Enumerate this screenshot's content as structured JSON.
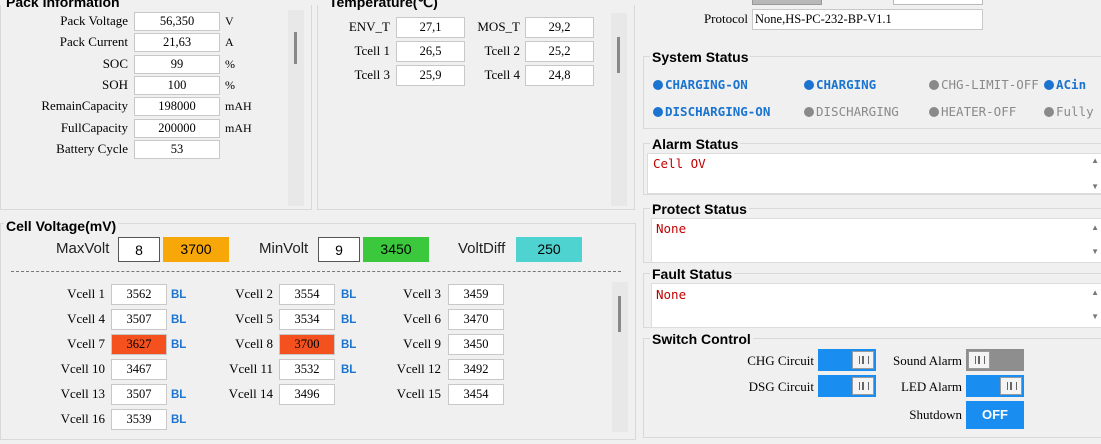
{
  "pack": {
    "title": "Pack Information",
    "rows": [
      {
        "label": "Pack Voltage",
        "value": "56,350",
        "unit": "V"
      },
      {
        "label": "Pack Current",
        "value": "21,63",
        "unit": "A"
      },
      {
        "label": "SOC",
        "value": "99",
        "unit": "%"
      },
      {
        "label": "SOH",
        "value": "100",
        "unit": "%"
      },
      {
        "label": "RemainCapacity",
        "value": "198000",
        "unit": "mAH"
      },
      {
        "label": "FullCapacity",
        "value": "200000",
        "unit": "mAH"
      },
      {
        "label": "Battery Cycle",
        "value": "53",
        "unit": ""
      }
    ]
  },
  "temperature": {
    "title": "Temperature(℃)",
    "items": [
      {
        "label": "ENV_T",
        "value": "27,1"
      },
      {
        "label": "MOS_T",
        "value": "29,2"
      },
      {
        "label": "Tcell 1",
        "value": "26,5"
      },
      {
        "label": "Tcell 2",
        "value": "25,2"
      },
      {
        "label": "Tcell 3",
        "value": "25,9"
      },
      {
        "label": "Tcell 4",
        "value": "24,8"
      }
    ]
  },
  "cellvolt": {
    "title": "Cell Voltage(mV)",
    "max_label": "MaxVolt",
    "max_index": "8",
    "max_value": "3700",
    "min_label": "MinVolt",
    "min_index": "9",
    "min_value": "3450",
    "diff_label": "VoltDiff",
    "diff_value": "250",
    "balance_tag": "BL",
    "cells": [
      {
        "label": "Vcell 1",
        "value": "3562",
        "bl": true,
        "hl": false
      },
      {
        "label": "Vcell 2",
        "value": "3554",
        "bl": true,
        "hl": false
      },
      {
        "label": "Vcell 3",
        "value": "3459",
        "bl": false,
        "hl": false
      },
      {
        "label": "Vcell 4",
        "value": "3507",
        "bl": true,
        "hl": false
      },
      {
        "label": "Vcell 5",
        "value": "3534",
        "bl": true,
        "hl": false
      },
      {
        "label": "Vcell 6",
        "value": "3470",
        "bl": false,
        "hl": false
      },
      {
        "label": "Vcell 7",
        "value": "3627",
        "bl": true,
        "hl": true
      },
      {
        "label": "Vcell 8",
        "value": "3700",
        "bl": true,
        "hl": true
      },
      {
        "label": "Vcell 9",
        "value": "3450",
        "bl": false,
        "hl": false
      },
      {
        "label": "Vcell 10",
        "value": "3467",
        "bl": false,
        "hl": false
      },
      {
        "label": "Vcell 11",
        "value": "3532",
        "bl": true,
        "hl": false
      },
      {
        "label": "Vcell 12",
        "value": "3492",
        "bl": false,
        "hl": false
      },
      {
        "label": "Vcell 13",
        "value": "3507",
        "bl": true,
        "hl": false
      },
      {
        "label": "Vcell 14",
        "value": "3496",
        "bl": false,
        "hl": false
      },
      {
        "label": "Vcell 15",
        "value": "3454",
        "bl": false,
        "hl": false
      },
      {
        "label": "Vcell 16",
        "value": "3539",
        "bl": true,
        "hl": false
      }
    ]
  },
  "protocol": {
    "label": "Protocol",
    "value": "None,HS-PC-232-BP-V1.1"
  },
  "system_status": {
    "title": "System Status",
    "items": [
      {
        "text": "CHARGING-ON",
        "on": true
      },
      {
        "text": "CHARGING",
        "on": true
      },
      {
        "text": "CHG-LIMIT-OFF",
        "on": false
      },
      {
        "text": "ACin",
        "on": true
      },
      {
        "text": "DISCHARGING-ON",
        "on": true
      },
      {
        "text": "DISCHARGING",
        "on": false
      },
      {
        "text": "HEATER-OFF",
        "on": false
      },
      {
        "text": "Fully",
        "on": false
      }
    ]
  },
  "alarm": {
    "title": "Alarm Status",
    "text": "Cell OV"
  },
  "protect": {
    "title": "Protect Status",
    "text": "None"
  },
  "fault": {
    "title": "Fault Status",
    "text": "None"
  },
  "switch": {
    "title": "Switch Control",
    "chg_label": "CHG Circuit",
    "dsg_label": "DSG Circuit",
    "sound_label": "Sound Alarm",
    "led_label": "LED Alarm",
    "shutdown_label": "Shutdown",
    "shutdown_button": "OFF"
  },
  "colors": {
    "accent": "#1a74d0",
    "max_box": "#f7a808",
    "min_box": "#3cc83c",
    "diff_box": "#4fd3d0",
    "cell_highlight": "#f4511e",
    "alarm_text": "#c00000"
  }
}
